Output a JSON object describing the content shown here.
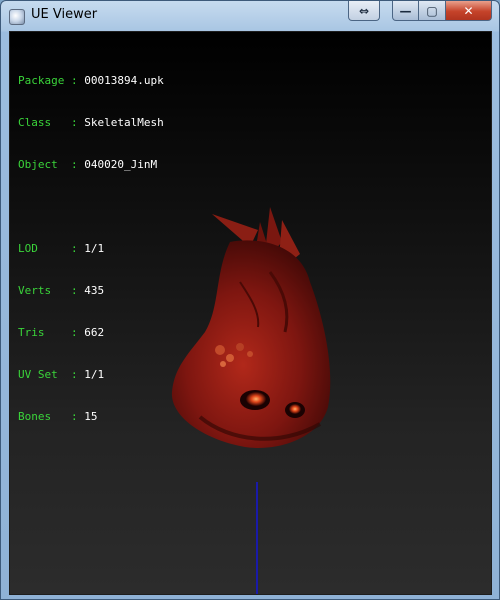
{
  "window": {
    "title": "UE Viewer",
    "buttons": {
      "restore_size": "⇔",
      "minimize": "—",
      "maximize": "▢",
      "close": "✕"
    }
  },
  "info": [
    {
      "key": "Package",
      "sep": " : ",
      "value": "00013894.upk"
    },
    {
      "key": "Class  ",
      "sep": " : ",
      "value": "SkeletalMesh"
    },
    {
      "key": "Object ",
      "sep": " : ",
      "value": "040020_JinM"
    },
    {
      "key": "LOD    ",
      "sep": " : ",
      "value": "1/1"
    },
    {
      "key": "Verts  ",
      "sep": " : ",
      "value": "435"
    },
    {
      "key": "Tris   ",
      "sep": " : ",
      "value": "662"
    },
    {
      "key": "UV Set ",
      "sep": " : ",
      "value": "1/1"
    },
    {
      "key": "Bones  ",
      "sep": " : ",
      "value": "15"
    }
  ],
  "colors": {
    "key": "#3ad43a",
    "value": "#ffffff",
    "mesh": "#8b1a12",
    "axis": "#1a1aa8"
  },
  "viewport": {
    "model_icon": "red-creature-head-mesh"
  }
}
